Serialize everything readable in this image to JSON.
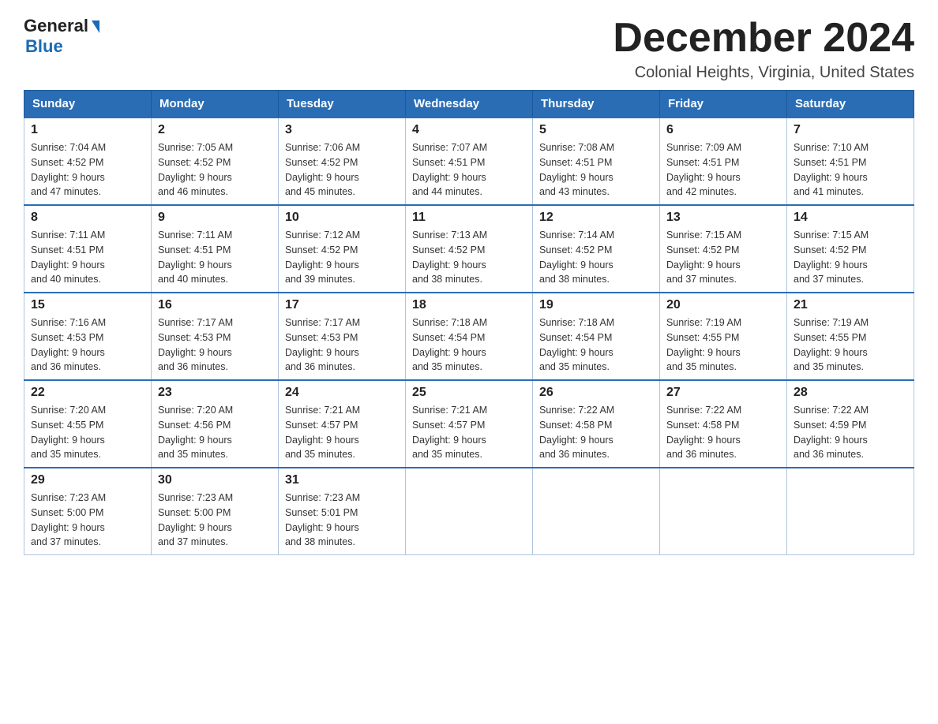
{
  "header": {
    "logo_general": "General",
    "logo_blue": "Blue",
    "month_title": "December 2024",
    "subtitle": "Colonial Heights, Virginia, United States"
  },
  "days_of_week": [
    "Sunday",
    "Monday",
    "Tuesday",
    "Wednesday",
    "Thursday",
    "Friday",
    "Saturday"
  ],
  "weeks": [
    [
      {
        "day": "1",
        "sunrise": "7:04 AM",
        "sunset": "4:52 PM",
        "daylight": "9 hours and 47 minutes."
      },
      {
        "day": "2",
        "sunrise": "7:05 AM",
        "sunset": "4:52 PM",
        "daylight": "9 hours and 46 minutes."
      },
      {
        "day": "3",
        "sunrise": "7:06 AM",
        "sunset": "4:52 PM",
        "daylight": "9 hours and 45 minutes."
      },
      {
        "day": "4",
        "sunrise": "7:07 AM",
        "sunset": "4:51 PM",
        "daylight": "9 hours and 44 minutes."
      },
      {
        "day": "5",
        "sunrise": "7:08 AM",
        "sunset": "4:51 PM",
        "daylight": "9 hours and 43 minutes."
      },
      {
        "day": "6",
        "sunrise": "7:09 AM",
        "sunset": "4:51 PM",
        "daylight": "9 hours and 42 minutes."
      },
      {
        "day": "7",
        "sunrise": "7:10 AM",
        "sunset": "4:51 PM",
        "daylight": "9 hours and 41 minutes."
      }
    ],
    [
      {
        "day": "8",
        "sunrise": "7:11 AM",
        "sunset": "4:51 PM",
        "daylight": "9 hours and 40 minutes."
      },
      {
        "day": "9",
        "sunrise": "7:11 AM",
        "sunset": "4:51 PM",
        "daylight": "9 hours and 40 minutes."
      },
      {
        "day": "10",
        "sunrise": "7:12 AM",
        "sunset": "4:52 PM",
        "daylight": "9 hours and 39 minutes."
      },
      {
        "day": "11",
        "sunrise": "7:13 AM",
        "sunset": "4:52 PM",
        "daylight": "9 hours and 38 minutes."
      },
      {
        "day": "12",
        "sunrise": "7:14 AM",
        "sunset": "4:52 PM",
        "daylight": "9 hours and 38 minutes."
      },
      {
        "day": "13",
        "sunrise": "7:15 AM",
        "sunset": "4:52 PM",
        "daylight": "9 hours and 37 minutes."
      },
      {
        "day": "14",
        "sunrise": "7:15 AM",
        "sunset": "4:52 PM",
        "daylight": "9 hours and 37 minutes."
      }
    ],
    [
      {
        "day": "15",
        "sunrise": "7:16 AM",
        "sunset": "4:53 PM",
        "daylight": "9 hours and 36 minutes."
      },
      {
        "day": "16",
        "sunrise": "7:17 AM",
        "sunset": "4:53 PM",
        "daylight": "9 hours and 36 minutes."
      },
      {
        "day": "17",
        "sunrise": "7:17 AM",
        "sunset": "4:53 PM",
        "daylight": "9 hours and 36 minutes."
      },
      {
        "day": "18",
        "sunrise": "7:18 AM",
        "sunset": "4:54 PM",
        "daylight": "9 hours and 35 minutes."
      },
      {
        "day": "19",
        "sunrise": "7:18 AM",
        "sunset": "4:54 PM",
        "daylight": "9 hours and 35 minutes."
      },
      {
        "day": "20",
        "sunrise": "7:19 AM",
        "sunset": "4:55 PM",
        "daylight": "9 hours and 35 minutes."
      },
      {
        "day": "21",
        "sunrise": "7:19 AM",
        "sunset": "4:55 PM",
        "daylight": "9 hours and 35 minutes."
      }
    ],
    [
      {
        "day": "22",
        "sunrise": "7:20 AM",
        "sunset": "4:55 PM",
        "daylight": "9 hours and 35 minutes."
      },
      {
        "day": "23",
        "sunrise": "7:20 AM",
        "sunset": "4:56 PM",
        "daylight": "9 hours and 35 minutes."
      },
      {
        "day": "24",
        "sunrise": "7:21 AM",
        "sunset": "4:57 PM",
        "daylight": "9 hours and 35 minutes."
      },
      {
        "day": "25",
        "sunrise": "7:21 AM",
        "sunset": "4:57 PM",
        "daylight": "9 hours and 35 minutes."
      },
      {
        "day": "26",
        "sunrise": "7:22 AM",
        "sunset": "4:58 PM",
        "daylight": "9 hours and 36 minutes."
      },
      {
        "day": "27",
        "sunrise": "7:22 AM",
        "sunset": "4:58 PM",
        "daylight": "9 hours and 36 minutes."
      },
      {
        "day": "28",
        "sunrise": "7:22 AM",
        "sunset": "4:59 PM",
        "daylight": "9 hours and 36 minutes."
      }
    ],
    [
      {
        "day": "29",
        "sunrise": "7:23 AM",
        "sunset": "5:00 PM",
        "daylight": "9 hours and 37 minutes."
      },
      {
        "day": "30",
        "sunrise": "7:23 AM",
        "sunset": "5:00 PM",
        "daylight": "9 hours and 37 minutes."
      },
      {
        "day": "31",
        "sunrise": "7:23 AM",
        "sunset": "5:01 PM",
        "daylight": "9 hours and 38 minutes."
      },
      null,
      null,
      null,
      null
    ]
  ],
  "labels": {
    "sunrise_prefix": "Sunrise: ",
    "sunset_prefix": "Sunset: ",
    "daylight_prefix": "Daylight: "
  }
}
